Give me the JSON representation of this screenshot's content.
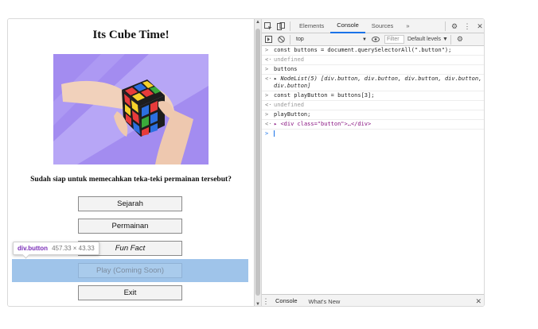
{
  "page": {
    "title": "Its Cube Time!",
    "question": "Sudah siap untuk memecahkan teka-teki permainan tersebut?",
    "buttons": [
      {
        "label": "Sejarah",
        "italic": false
      },
      {
        "label": "Permainan",
        "italic": false
      },
      {
        "label": "Fun Fact",
        "italic": true
      },
      {
        "label": "Play (Coming Soon)",
        "italic": false
      },
      {
        "label": "Exit",
        "italic": false
      }
    ],
    "highlight_color": "#9fc4ea"
  },
  "tooltip": {
    "name": "div.button",
    "size": "457.33 × 43.33"
  },
  "devtools": {
    "tabs": [
      "Elements",
      "Console",
      "Sources"
    ],
    "active_tab": "Console",
    "more": "»",
    "context": "top",
    "filter_placeholder": "Filter",
    "levels": "Default levels ▼",
    "console_lines": [
      {
        "kind": "input",
        "text": "const buttons = document.querySelectorAll(\".button\");"
      },
      {
        "kind": "result",
        "text": "undefined"
      },
      {
        "kind": "input",
        "text": "buttons"
      },
      {
        "kind": "object",
        "text": "NodeList(5) [div.button, div.button, div.button, div.button, div.button]"
      },
      {
        "kind": "input",
        "text": "const playButton = buttons[3];"
      },
      {
        "kind": "result",
        "text": "undefined"
      },
      {
        "kind": "input",
        "text": "playButton;"
      },
      {
        "kind": "element",
        "text": "<div class=\"button\">…</div>"
      }
    ],
    "drawer_tabs": [
      "Console",
      "What's New"
    ],
    "accent": "#1a73e8"
  }
}
